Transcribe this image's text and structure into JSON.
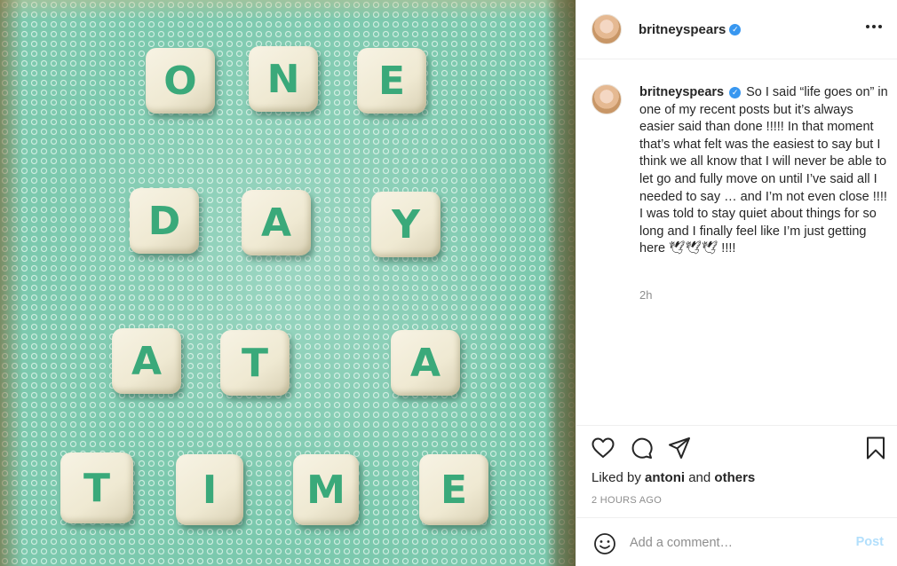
{
  "media": {
    "dice_rows": [
      [
        "O",
        "N",
        "E"
      ],
      [
        "D",
        "A",
        "Y"
      ],
      [
        "A",
        "T",
        "A"
      ],
      [
        "T",
        "I",
        "M",
        "E"
      ]
    ]
  },
  "header": {
    "username": "britneyspears",
    "verified_icon": "verified-badge-icon",
    "more_icon": "more-options-icon"
  },
  "caption": {
    "username": "britneyspears",
    "text": "So I said “life goes on” in one of my recent posts but it’s always easier said than done !!!!! In that moment that’s what felt was the easiest to say but I think we all know that I will never be able to let go and fully move on until I’ve said all I needed to say … and I’m not even close !!!! I was told to stay quiet about things for so long and I finally feel like I’m just getting here 🕊🕊🕊 !!!!",
    "time_ago": "2h"
  },
  "actions": {
    "icons": [
      "heart-icon",
      "comment-icon",
      "share-icon",
      "bookmark-icon"
    ],
    "liked_by_prefix": "Liked by",
    "liked_by_user": "antoni",
    "liked_by_and": "and",
    "liked_by_others": "others",
    "timestamp": "2 HOURS AGO"
  },
  "comment_bar": {
    "placeholder": "Add a comment…",
    "post_label": "Post",
    "emoji_icon": "smiley-icon"
  },
  "colors": {
    "accent_blue": "#3897f0",
    "post_disabled": "#b2dffc",
    "board_green": "#7cc9ae",
    "letter_green": "#3aa97a"
  }
}
